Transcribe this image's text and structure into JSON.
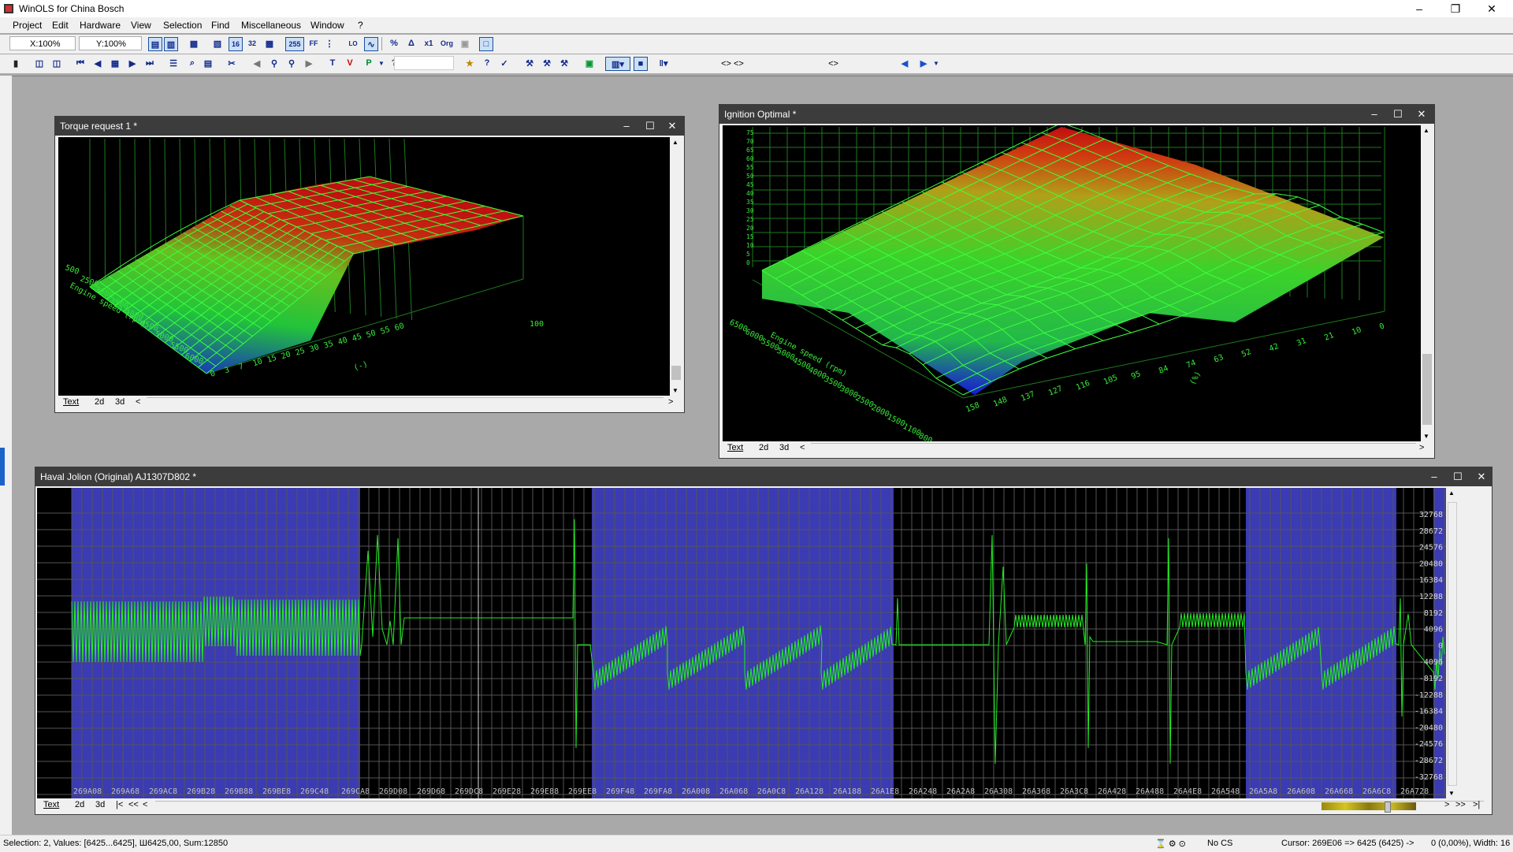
{
  "app": {
    "title": "WinOLS for China Bosch",
    "window_controls": [
      "–",
      "❐",
      "✕"
    ]
  },
  "menu": [
    "Project",
    "Edit",
    "Hardware",
    "View",
    "Selection",
    "Find",
    "Miscellaneous",
    "Window",
    "?"
  ],
  "toolbar1": {
    "x_zoom": "X:100%",
    "y_zoom": "Y:100%",
    "buttons": [
      "16",
      "32",
      "255",
      "FF",
      "%",
      "x1",
      "Org"
    ]
  },
  "toolbar2": {
    "help_label": "?",
    "combo_a": "<> <>",
    "combo_b": "<>"
  },
  "windows": {
    "torque": {
      "title": "Torque request 1 *",
      "tabs": [
        "Text",
        "2d",
        "3d"
      ],
      "x_axis_label": "Engine speed (rpm)",
      "x_ticks": [
        "500",
        "2500",
        "3000",
        "3500",
        "4000",
        "4500",
        "5000",
        "5500",
        "6000"
      ],
      "y_ticks": [
        "0",
        "3",
        "7",
        "10",
        "15",
        "20",
        "25",
        "30",
        "35",
        "40",
        "45",
        "50",
        "55",
        "60",
        "100"
      ],
      "y_unit": "(-)",
      "colors": {
        "low": "#1a1ad8",
        "mid": "#2ed62e",
        "high": "#cc1010",
        "grid": "#33ff33"
      }
    },
    "ignition": {
      "title": "Ignition Optimal *",
      "tabs": [
        "Text",
        "2d",
        "3d"
      ],
      "x_axis_label": "Engine speed (rpm)",
      "x_ticks": [
        "6500",
        "6000",
        "5500",
        "5000",
        "4500",
        "4000",
        "3500",
        "3000",
        "2500",
        "2000",
        "1500",
        "1100",
        "800"
      ],
      "y_ticks": [
        "158",
        "148",
        "137",
        "127",
        "116",
        "105",
        "95",
        "84",
        "74",
        "63",
        "52",
        "42",
        "31",
        "21",
        "10",
        "0"
      ],
      "y_unit": "(%)",
      "z_ticks": [
        "75",
        "70",
        "65",
        "60",
        "55",
        "50",
        "45",
        "40",
        "35",
        "30",
        "25",
        "20",
        "15",
        "10",
        "5",
        "0"
      ]
    },
    "hex": {
      "title": "Haval Jolion (Original) AJ1307D802 *",
      "tabs": [
        "Text",
        "2d",
        "3d"
      ],
      "nav": [
        "|<",
        "<<",
        "<",
        ">",
        ">>",
        ">|"
      ],
      "y_labels": [
        "32768",
        "28672",
        "24576",
        "20480",
        "16384",
        "12288",
        "8192",
        "4096",
        "0",
        "-4096",
        "-8192",
        "-12288",
        "-16384",
        "-20480",
        "-24576",
        "-28672",
        "-32768"
      ],
      "x_labels": [
        "269A08",
        "269A68",
        "269AC8",
        "269B28",
        "269B88",
        "269BE8",
        "269C48",
        "269CA8",
        "269D08",
        "269D68",
        "269DC8",
        "269E28",
        "269E88",
        "269EE8",
        "269F48",
        "269FA8",
        "26A008",
        "26A068",
        "26A0C8",
        "26A128",
        "26A188",
        "26A1E8",
        "26A248",
        "26A2A8",
        "26A308",
        "26A368",
        "26A3C8",
        "26A428",
        "26A488",
        "26A4E8",
        "26A548",
        "26A5A8",
        "26A608",
        "26A668",
        "26A6C8",
        "26A728"
      ],
      "selection_color": "#3b3bb3",
      "curve_color": "#22ee22"
    }
  },
  "status": {
    "selection": "Selection: 2, Values: [6425...6425], Ш6425,00, Sum:12850",
    "cs": "No CS",
    "cursor": "Cursor: 269E06 => 6425 (6425) ->",
    "width": "0 (0,00%), Width: 16"
  }
}
